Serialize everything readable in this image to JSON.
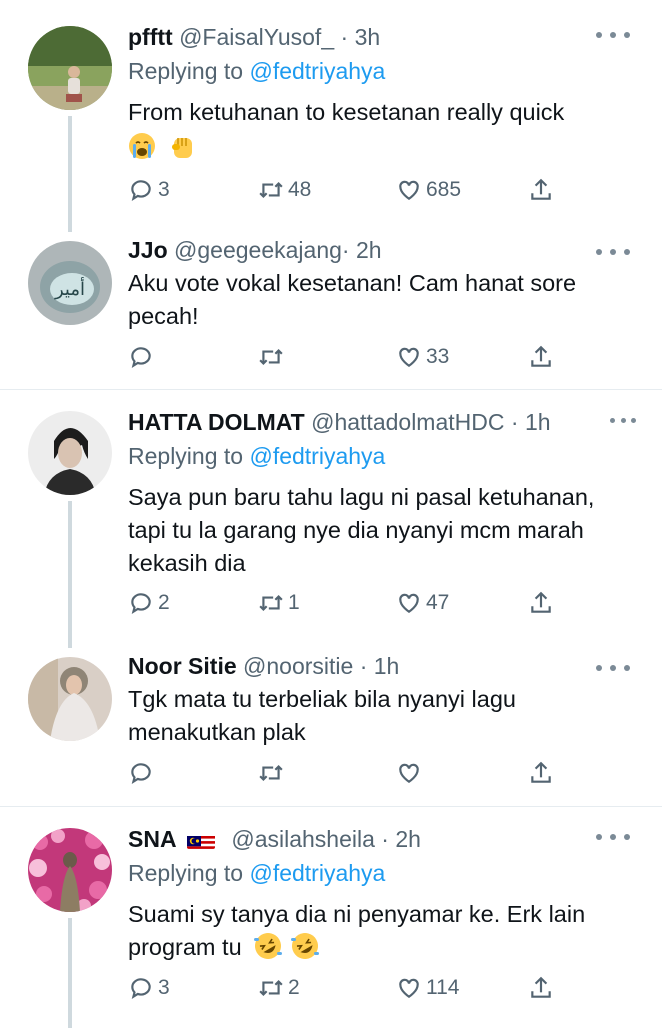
{
  "tweets": [
    {
      "name": "pfftt",
      "handle": "@FaisalYusof_",
      "dot": "·",
      "time": "3h",
      "replying_prefix": "Replying to",
      "replying_to": "@fedtriyahya",
      "text": "From ketuhanan to kesetanan really quick",
      "emojis": [
        "crying-face",
        "raised-fist"
      ],
      "replies": "3",
      "retweets": "48",
      "likes": "685"
    },
    {
      "name": "JJo",
      "handle": "@geegeekajang",
      "dot": "·",
      "time": "2h",
      "text_line1": "Aku vote vokal kesetanan! Cam hanat sore",
      "text_line2": "pecah!",
      "replies": "",
      "retweets": "",
      "likes": "33"
    },
    {
      "name": "HATTA DOLMAT",
      "handle": "@hattadolmatHDC",
      "dot": "·",
      "time": "1h",
      "replying_prefix": "Replying to",
      "replying_to": "@fedtriyahya",
      "text_line1": "Saya pun baru tahu lagu ni pasal ketuhanan,",
      "text_line2": "tapi tu la garang nye dia nyanyi mcm marah",
      "text_line3": "kekasih dia",
      "replies": "2",
      "retweets": "1",
      "likes": "47"
    },
    {
      "name": "Noor Sitie",
      "handle": "@noorsitie",
      "dot": "·",
      "time": "1h",
      "text_line1": "Tgk mata tu terbeliak bila nyanyi lagu",
      "text_line2": "menakutkan plak",
      "replies": "",
      "retweets": "",
      "likes": ""
    },
    {
      "name": "SNA",
      "flag": "malaysia-flag",
      "handle": "@asilahsheila",
      "dot": "·",
      "time": "2h",
      "replying_prefix": "Replying to",
      "replying_to": "@fedtriyahya",
      "text_line1": "Suami sy tanya dia ni penyamar ke. Erk lain",
      "text_line2": "program tu",
      "emojis": [
        "rolling-on-floor-laughing",
        "rolling-on-floor-laughing"
      ],
      "replies": "3",
      "retweets": "2",
      "likes": "114"
    }
  ],
  "avatar_text_jjo": "أمير",
  "colors": {
    "text": "#0f1419",
    "secondary": "#536471",
    "link": "#1d9bf0",
    "thread_line": "#cfd9de",
    "divider": "#e6ecf0"
  }
}
